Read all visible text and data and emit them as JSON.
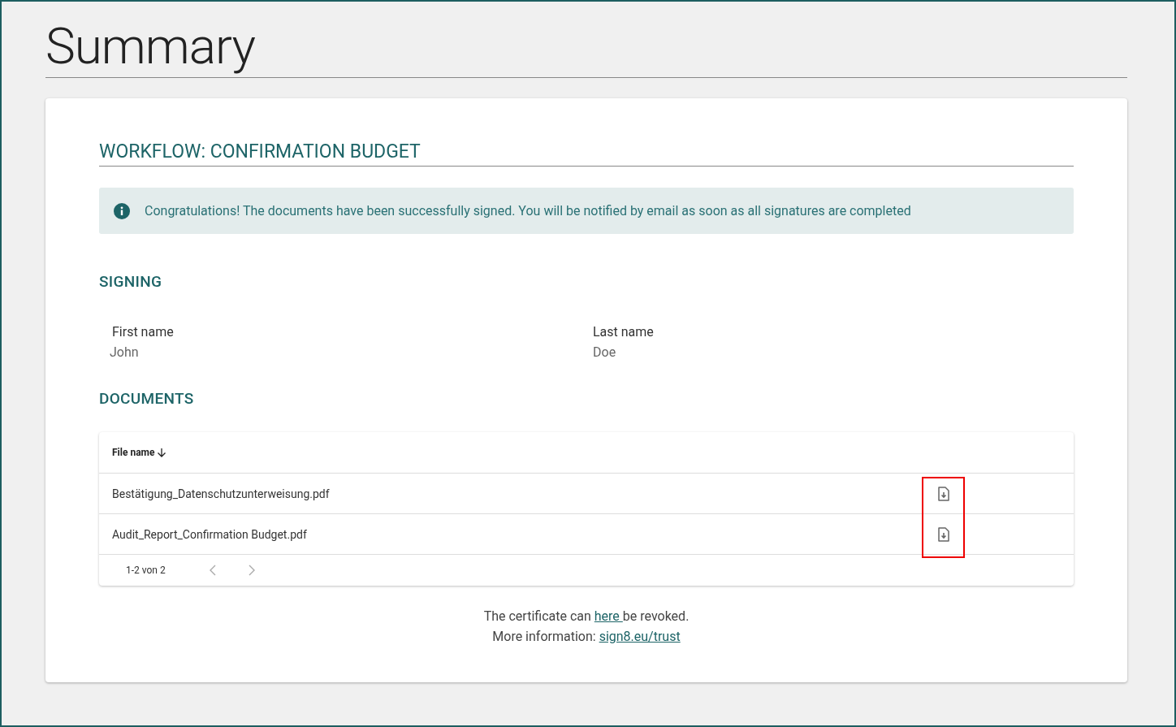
{
  "page_title": "Summary",
  "workflow_title": "WORKFLOW: CONFIRMATION BUDGET",
  "notice": {
    "kind": "info",
    "text": "Congratulations! The documents have been successfully signed. You will be notified by email as soon as all signatures are completed"
  },
  "signing": {
    "heading": "SIGNING",
    "fields": [
      {
        "label": "First name",
        "value": "John"
      },
      {
        "label": "Last name",
        "value": "Doe"
      }
    ]
  },
  "documents": {
    "heading": "DOCUMENTS",
    "column": "File name",
    "sorted_descending": true,
    "rows": [
      {
        "file": "Bestätigung_Datenschutzunterweisung.pdf"
      },
      {
        "file": "Audit_Report_Confirmation Budget.pdf"
      }
    ],
    "highlighted_downloads": true,
    "pagination": "1-2 von 2"
  },
  "footer": {
    "revoke": {
      "before": "The certificate can ",
      "link": "here ",
      "after": "be revoked."
    },
    "info": {
      "before": "More information: ",
      "link": "sign8.eu/trust"
    }
  }
}
